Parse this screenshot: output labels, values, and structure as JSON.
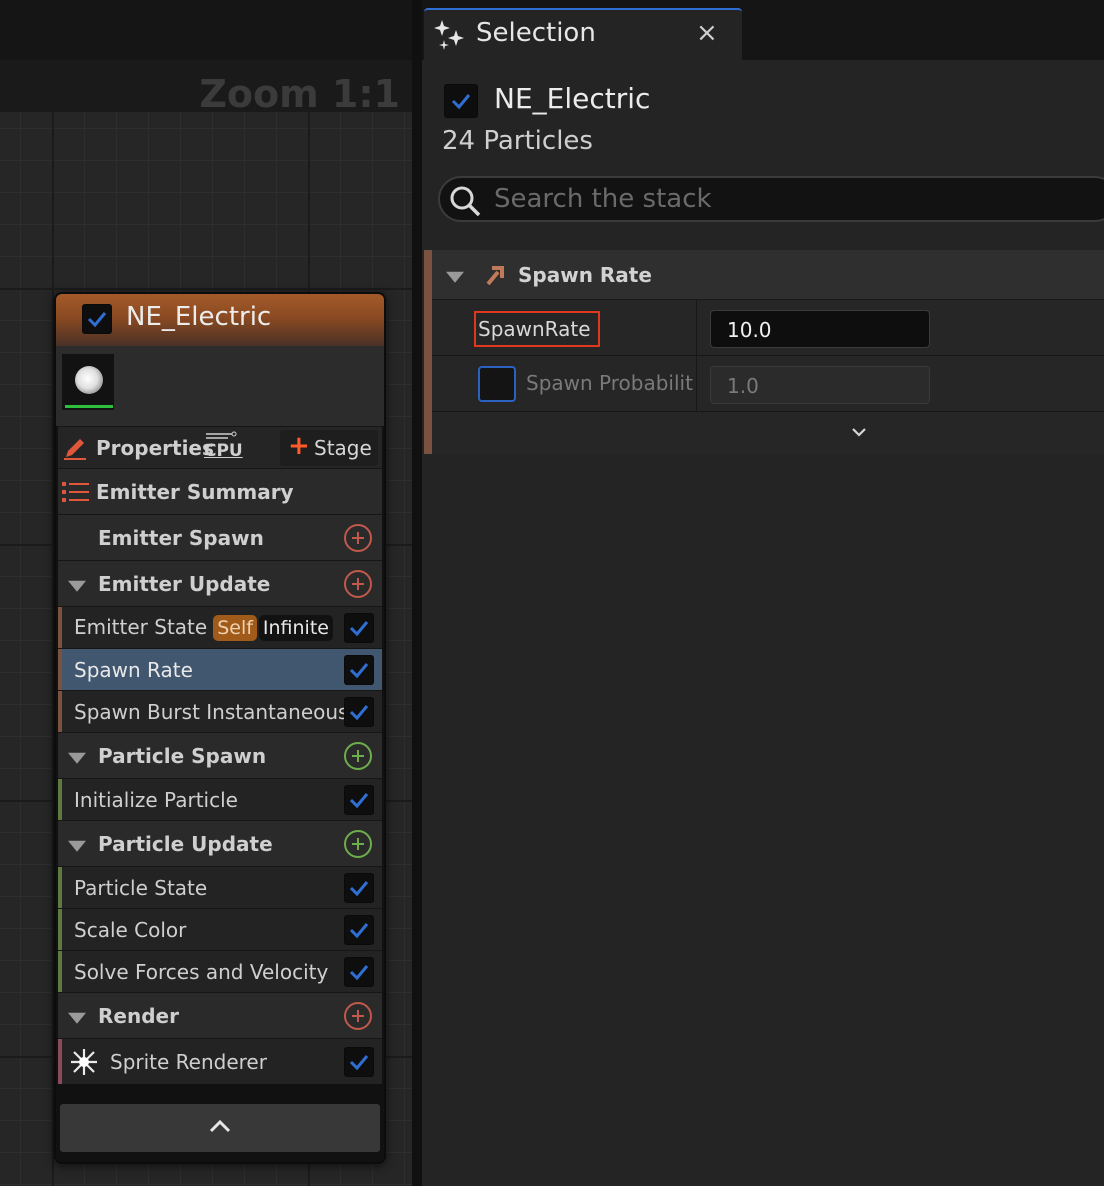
{
  "graph": {
    "zoom_label": "Zoom 1:1"
  },
  "node": {
    "title": "NE_Electric",
    "properties_label": "Properties",
    "cpu_label": "CPU",
    "stage_label": "Stage",
    "rows": {
      "emitter_summary": "Emitter Summary",
      "emitter_spawn": "Emitter Spawn",
      "emitter_update": "Emitter Update",
      "emitter_state": "Emitter State",
      "emitter_state_badge_self": "Self",
      "emitter_state_badge_infinite": "Infinite",
      "spawn_rate": "Spawn Rate",
      "spawn_burst": "Spawn Burst Instantaneous",
      "particle_spawn": "Particle Spawn",
      "initialize_particle": "Initialize Particle",
      "particle_update": "Particle Update",
      "particle_state": "Particle State",
      "scale_color": "Scale Color",
      "solve_forces": "Solve Forces and Velocity",
      "render": "Render",
      "sprite_renderer": "Sprite Renderer"
    }
  },
  "panel": {
    "tab_title": "Selection",
    "close_glyph": "×",
    "emitter_name": "NE_Electric",
    "particle_count": "24 Particles",
    "search_placeholder": "Search the stack",
    "section_title": "Spawn Rate",
    "params": [
      {
        "name": "SpawnRate",
        "value": "10.0",
        "enabled": true
      },
      {
        "name": "Spawn Probabilit",
        "value": "1.0",
        "enabled": false
      }
    ]
  },
  "colors": {
    "accent_blue": "#2f6fd4",
    "selected_row": "#41576f",
    "highlight_border": "#e0381e",
    "emitter_header": "#a45a2a",
    "emitter_stripe": "#7b5140",
    "particle_stripe": "#5e7a3e",
    "render_stripe": "#8a4a5a"
  },
  "icons": {
    "selection_tab": "sparkles-icon",
    "checkbox": "check-icon",
    "search": "search-icon",
    "add": "plus-circle-icon",
    "collapse": "chevron-up-icon",
    "expand": "chevron-down-icon",
    "properties": "pencil-icon",
    "summary": "list-icon",
    "sprite_renderer": "sparkle-burst-icon",
    "spawn_rate": "arrow-up-right-icon"
  }
}
